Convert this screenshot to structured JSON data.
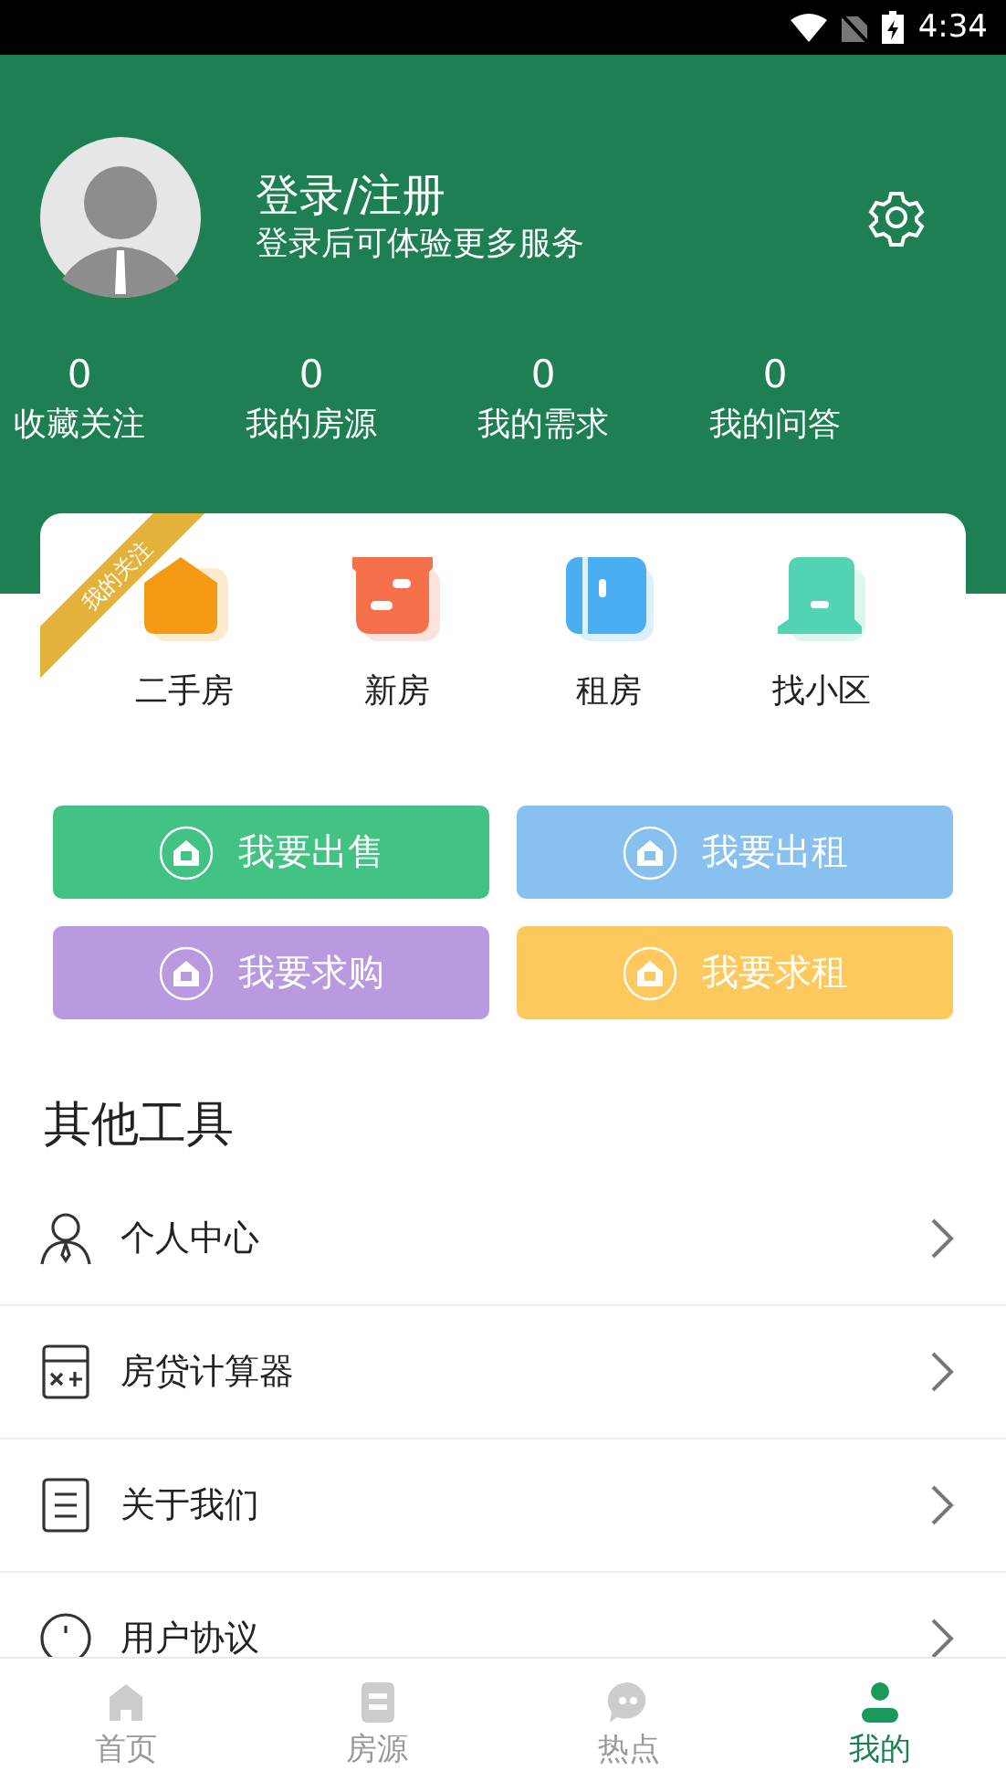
{
  "status_bar": {
    "time": "4:34"
  },
  "profile": {
    "title": "登录/注册",
    "subtitle": "登录后可体验更多服务"
  },
  "stats": [
    {
      "value": "0",
      "label": "收藏关注"
    },
    {
      "value": "0",
      "label": "我的房源"
    },
    {
      "value": "0",
      "label": "我的需求"
    },
    {
      "value": "0",
      "label": "我的问答"
    }
  ],
  "ribbon": "我的关注",
  "categories": [
    {
      "kind": "house",
      "label": "二手房",
      "color": "#f39a12"
    },
    {
      "kind": "box",
      "label": "新房",
      "color": "#f5714c"
    },
    {
      "kind": "door",
      "label": "租房",
      "color": "#4aaef3"
    },
    {
      "kind": "building",
      "label": "找小区",
      "color": "#52d3b2"
    }
  ],
  "actions": [
    {
      "label": "我要出售",
      "color": "#42c383"
    },
    {
      "label": "我要出租",
      "color": "#88c1ef"
    },
    {
      "label": "我要求购",
      "color": "#b99ae0"
    },
    {
      "label": "我要求租",
      "color": "#fdc95c"
    }
  ],
  "section_title": "其他工具",
  "tools": [
    {
      "kind": "person",
      "label": "个人中心"
    },
    {
      "kind": "calculator",
      "label": "房贷计算器"
    },
    {
      "kind": "info",
      "label": "关于我们"
    },
    {
      "kind": "agreement",
      "label": "用户协议"
    }
  ],
  "tabs": [
    {
      "kind": "home",
      "label": "首页",
      "selected": false
    },
    {
      "kind": "listing",
      "label": "房源",
      "selected": false
    },
    {
      "kind": "chat",
      "label": "热点",
      "selected": false
    },
    {
      "kind": "me",
      "label": "我的",
      "selected": true
    }
  ]
}
